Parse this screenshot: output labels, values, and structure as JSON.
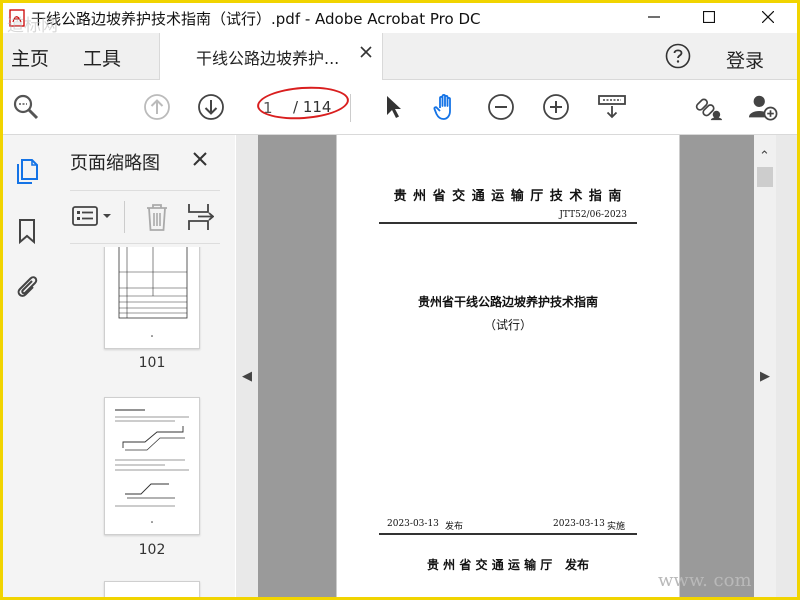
{
  "window": {
    "title": "干线公路边坡养护技术指南（试行）.pdf - Adobe Acrobat Pro DC"
  },
  "tabs": {
    "home": "主页",
    "tools": "工具",
    "document": "干线公路边坡养护...",
    "help_icon": "help-icon",
    "login": "登录"
  },
  "toolbar": {
    "current_page": "1",
    "page_total": "/ 114",
    "icons": [
      "zoom-icon",
      "page-up-icon",
      "page-down-icon",
      "select-arrow-icon",
      "hand-tool-icon",
      "zoom-out-icon",
      "zoom-in-icon",
      "fit-page-icon",
      "share-link-icon",
      "add-user-icon"
    ]
  },
  "sidebar": {
    "panel_title": "页面缩略图",
    "thumbnails": [
      {
        "page_number": "101"
      },
      {
        "page_number": "102"
      }
    ]
  },
  "document_page": {
    "issuer": "贵 州 省 交 通 运 输 厅 技 术 指 南",
    "code": "JTT52/06-2023",
    "title": "贵州省干线公路边坡养护技术指南",
    "subtitle": "（试行）",
    "publish_date": "2023-03-13",
    "publish_label": "发布",
    "implement_date": "2023-03-13",
    "implement_label": "实施",
    "publisher": "贵 州 省 交 通 运 输 厅",
    "publisher_action": "发布"
  },
  "watermarks": {
    "top_left": "道标网",
    "bottom_right": "www.         com"
  },
  "colors": {
    "border_yellow": "#f1d400",
    "annotation_red": "#d91e1e",
    "hand_tool_blue": "#1473e6"
  }
}
